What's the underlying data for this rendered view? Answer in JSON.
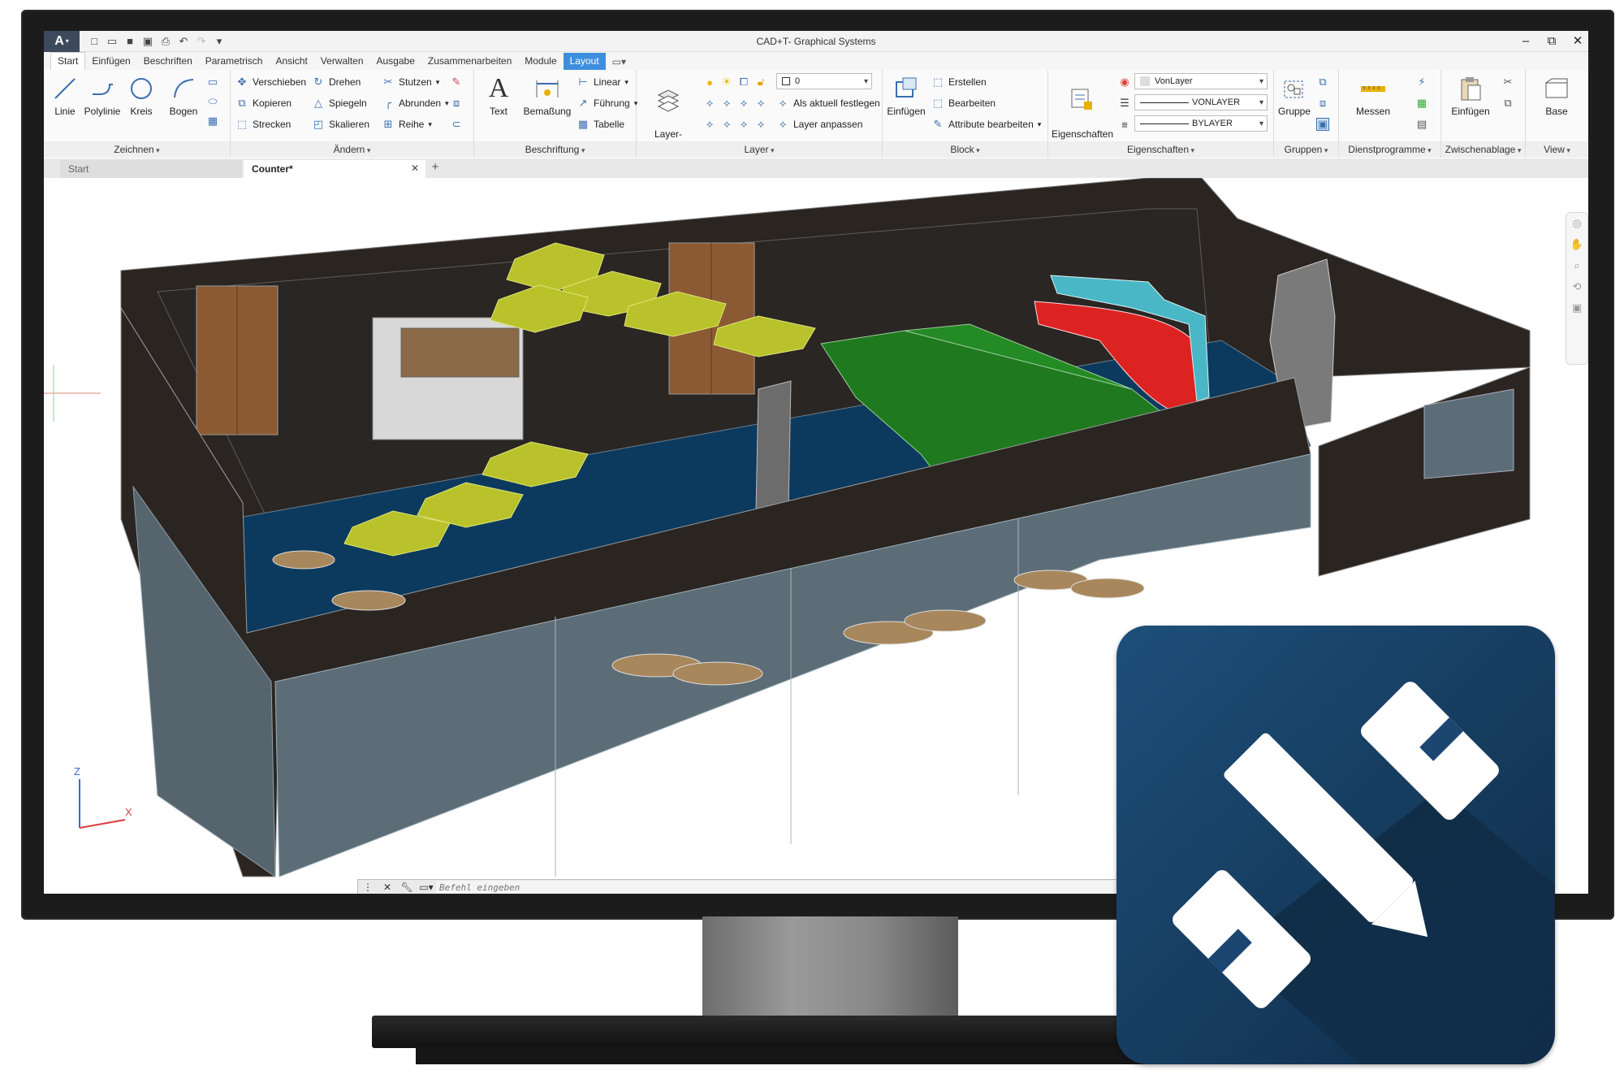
{
  "window": {
    "title": "CAD+T- Graphical Systems",
    "logo_letter": "A",
    "controls": [
      "–",
      "⧉",
      "✕"
    ]
  },
  "ribbon_tabs": [
    "Start",
    "Einfügen",
    "Beschriften",
    "Parametrisch",
    "Ansicht",
    "Verwalten",
    "Ausgabe",
    "Zusammenarbeiten",
    "Module",
    "Layout"
  ],
  "panels": {
    "zeichnen": {
      "label": "Zeichnen",
      "tools": [
        "Linie",
        "Polylinie",
        "Kreis",
        "Bogen"
      ]
    },
    "aendern": {
      "label": "Ändern",
      "tools": [
        "Verschieben",
        "Drehen",
        "Stutzen",
        "Kopieren",
        "Spiegeln",
        "Abrunden",
        "Strecken",
        "Skalieren",
        "Reihe"
      ]
    },
    "beschriftung": {
      "label": "Beschriftung",
      "tools": [
        "Text",
        "Bemaßung"
      ],
      "small": [
        "Linear",
        "Führung",
        "Tabelle"
      ]
    },
    "layer": {
      "label": "Layer",
      "big": "Layer-\nEigenschaften",
      "current_layer": "0",
      "small": [
        "Als aktuell festlegen",
        "Layer anpassen"
      ]
    },
    "block": {
      "label": "Block",
      "big": "Einfügen",
      "small": [
        "Erstellen",
        "Bearbeiten",
        "Attribute bearbeiten"
      ]
    },
    "eigenschaften": {
      "label": "Eigenschaften",
      "big": "Eigenschaften\nanpassen",
      "color": "VonLayer",
      "linetype": "VONLAYER",
      "lineweight": "BYLAYER"
    },
    "gruppen": {
      "label": "Gruppen",
      "big": "Gruppe"
    },
    "dienstprogramme": {
      "label": "Dienstprogramme",
      "big": "Messen"
    },
    "zwischenablage": {
      "label": "Zwischenablage",
      "big": "Einfügen"
    },
    "view": {
      "label": "View",
      "big": "Base"
    }
  },
  "doc_tabs": [
    {
      "label": "Start",
      "active": false
    },
    {
      "label": "Counter*",
      "active": true
    }
  ],
  "ucs": {
    "z": "Z",
    "x": "X"
  },
  "command_line": {
    "placeholder": "Befehl eingeben"
  },
  "colors": {
    "accent": "#3e8ede",
    "badge_top": "#1d4f7a",
    "badge_bottom": "#0f2c48",
    "wall": "#2a2521",
    "floor": "#0c3a5e",
    "hex_panel": "#b9c22a",
    "platform": "#1f7a1f"
  }
}
